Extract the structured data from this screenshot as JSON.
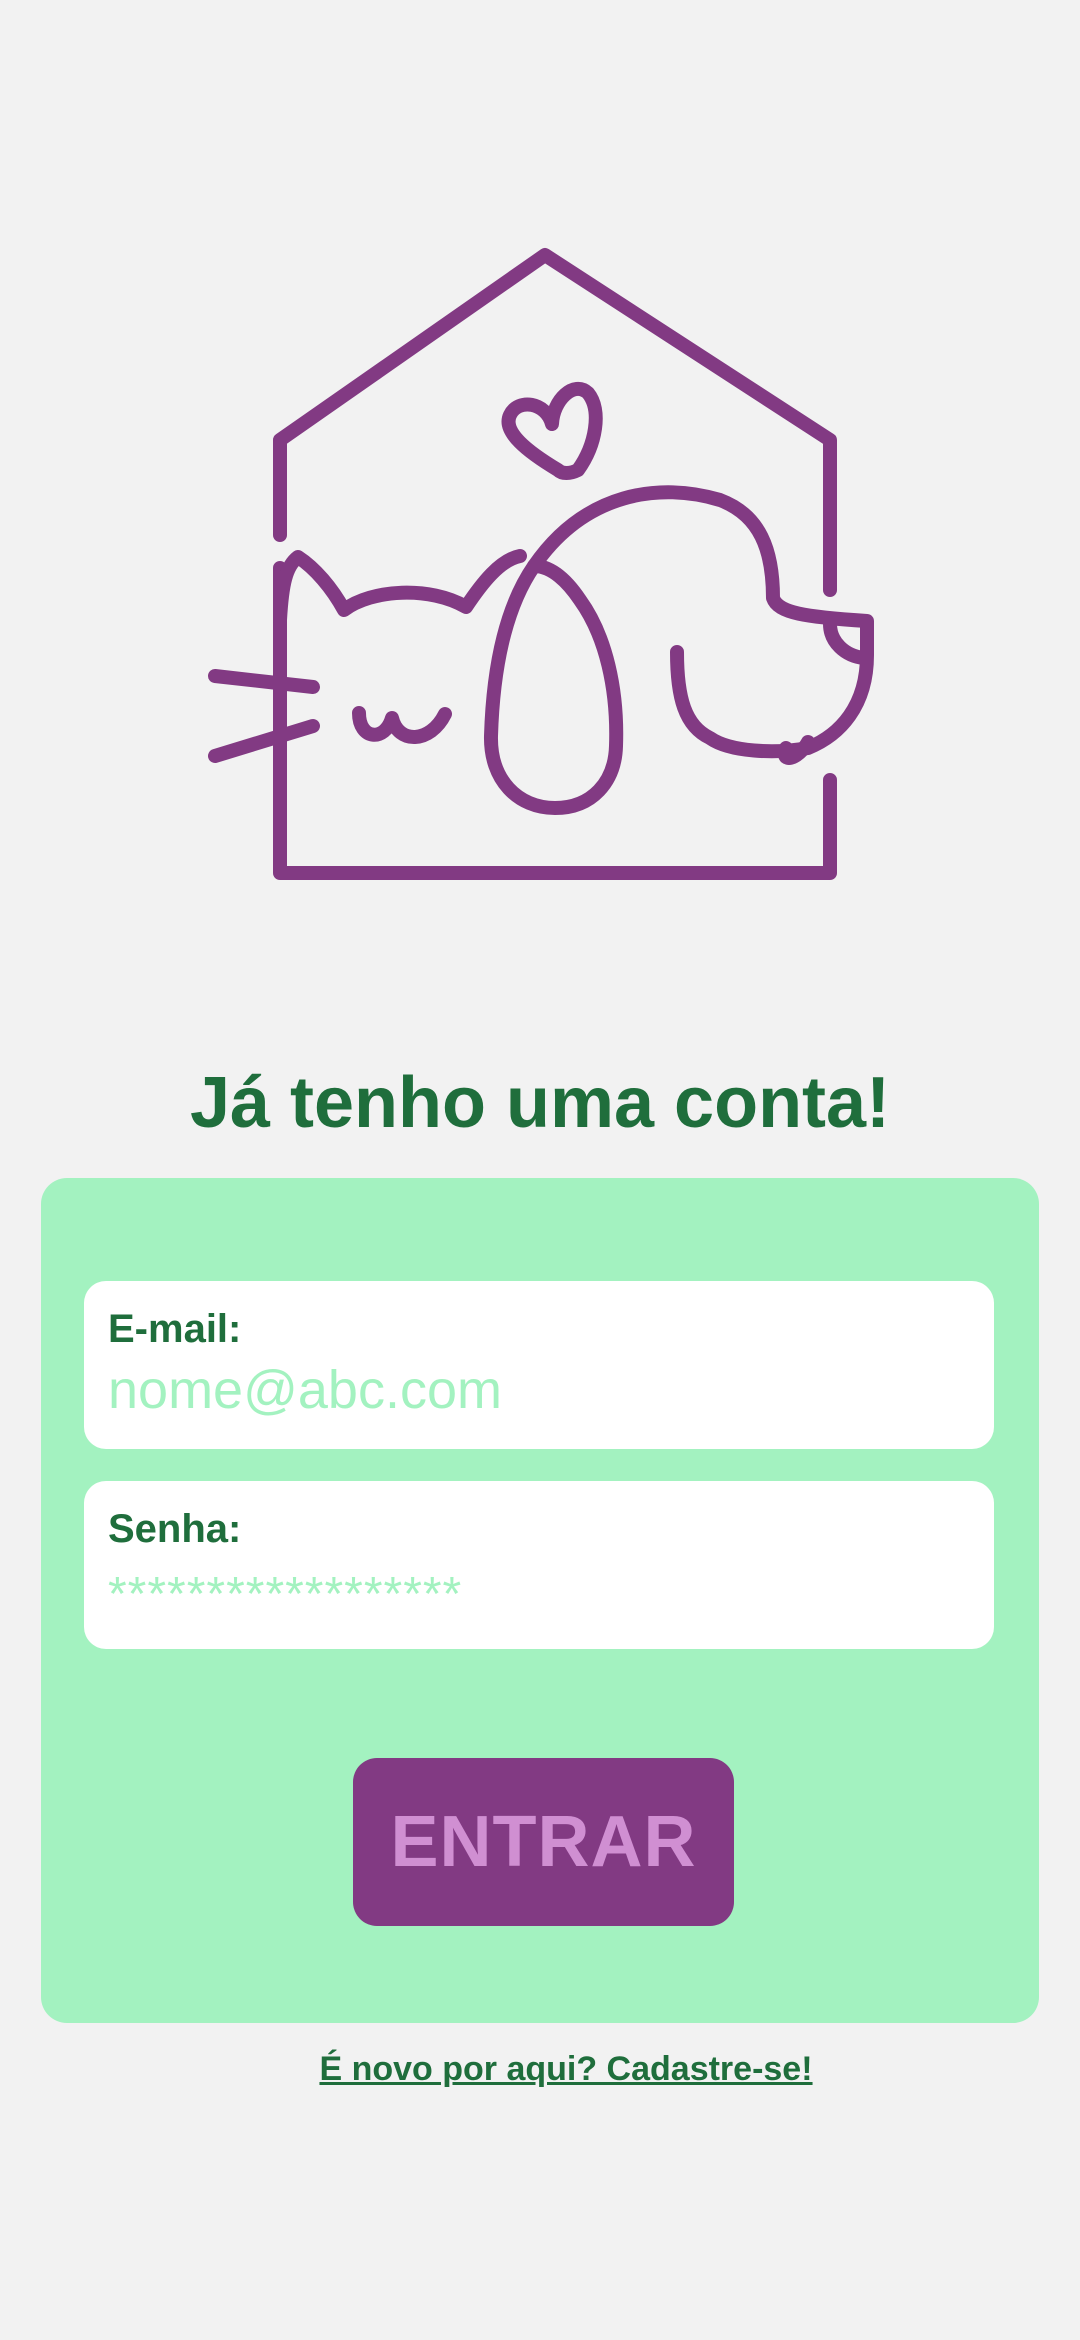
{
  "header": {
    "logo_icon": "pet-house-cat-dog-logo"
  },
  "login": {
    "title": "Já tenho uma conta!",
    "email": {
      "label": "E-mail:",
      "placeholder": "nome@abc.com"
    },
    "password": {
      "label": "Senha:",
      "placeholder": "******************"
    },
    "submit_label": "ENTRAR",
    "signup_link": "É novo por aqui? Cadastre-se!"
  },
  "colors": {
    "background": "#f2f2f2",
    "brand_green": "#1f6e3c",
    "card_green": "#a3f2c0",
    "brand_purple": "#823a83",
    "button_text": "#d08fd2"
  }
}
